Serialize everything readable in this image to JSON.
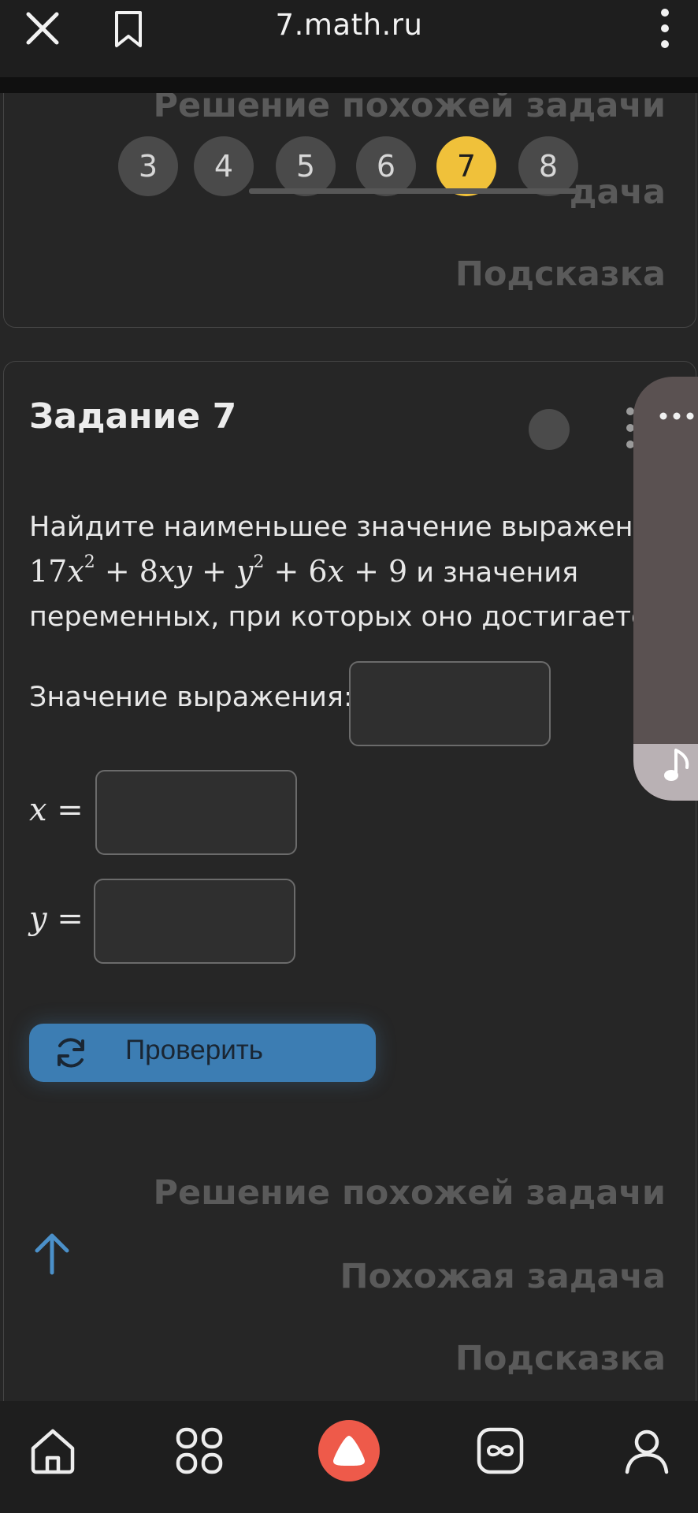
{
  "browser": {
    "url": "7.math.ru"
  },
  "previous_card": {
    "solution_link": "Решение похожей задачи",
    "similar_link_partial": "дача",
    "hint_link": "Подсказка"
  },
  "pager": {
    "pages": [
      "3",
      "4",
      "5",
      "6",
      "7",
      "8"
    ],
    "active": "7"
  },
  "task": {
    "title": "Задание 7",
    "text_before": "Найдите наименьшее значение выражения",
    "expression": {
      "c1": "17",
      "v1": "x",
      "e1": "2",
      "op1": " + 8",
      "v2": "xy",
      "op2": " + ",
      "v3": "y",
      "e3": "2",
      "op3": " + 6",
      "v4": "x",
      "op4": " + 9"
    },
    "text_middle": " и значения",
    "text_after": "переменных, при которых оно достигается.",
    "value_label": "Значение выражения:",
    "x_var": "x",
    "y_var": "y",
    "equals": " =",
    "value_input": "",
    "x_input": "",
    "y_input": "",
    "check_button": "Проверить",
    "solution_link": "Решение похожей задачи",
    "similar_link": "Похожая задача",
    "hint_link": "Подсказка"
  },
  "colors": {
    "background": "#262626",
    "accent_button": "#3c7db3",
    "active_page": "#f0c13a",
    "alice": "#ee5a4a"
  },
  "icons": {
    "close": "close-icon",
    "bookmark": "bookmark-icon",
    "menu": "more-vertical-icon",
    "refresh": "refresh-icon",
    "scroll_up": "arrow-up-icon",
    "home": "home-icon",
    "services": "grid-icon",
    "assistant": "alice-icon",
    "media": "infinity-icon",
    "profile": "profile-icon",
    "music": "music-note-icon"
  }
}
